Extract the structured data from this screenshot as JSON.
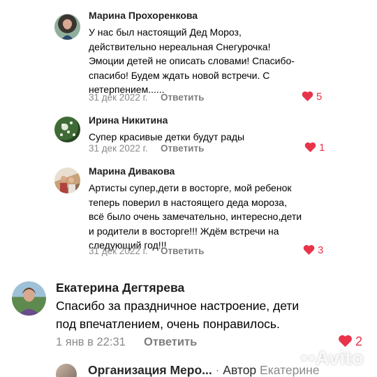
{
  "comments": [
    {
      "author": "Марина Прохоренкова",
      "lines": [
        "У нас был настоящий Дед Мороз,",
        "действительно нереальная Снегурочка!",
        "Эмоции детей не описать словами! Спасибо-",
        "спасибо! Будем ждать новой встречи. С",
        "нетерпением......"
      ],
      "date": "31 дек 2022 г.",
      "reply": "Ответить",
      "likes": "5"
    },
    {
      "author": "Ирина Никитина",
      "lines": [
        "Супер красивые детки будут рады"
      ],
      "date": "31 дек 2022 г.",
      "reply": "Ответить",
      "likes": "1"
    },
    {
      "author": "Марина Дивакова",
      "lines": [
        "Артисты супер,дети в восторге, мой ребенок",
        "теперь поверил в настоящего деда мороза,",
        "всё было очень замечательно, интересно,дети",
        "и родители в восторге!!! Ждём встречи на",
        "следующий год!!!"
      ],
      "date": "31 дек 2022 г.",
      "reply": "Ответить",
      "likes": "3"
    },
    {
      "author": "Екатерина Дегтярева",
      "lines": [
        "Спасибо за праздничное настроение, дети",
        "под впечатлением, очень понравилось."
      ],
      "date": "1 янв в 22:31",
      "reply": "Ответить",
      "likes": "2"
    }
  ],
  "reply_preview": {
    "author": "Организация Меро...",
    "separator": "·",
    "role": "Автор",
    "mention": "Екатерине"
  },
  "watermark": "Avito",
  "colors": {
    "like": "#e8344a",
    "meta": "#8a8a8a"
  },
  "icons": {
    "like": "heart-icon"
  }
}
